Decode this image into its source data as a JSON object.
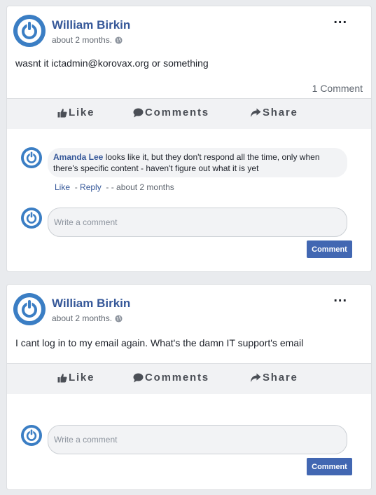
{
  "posts": [
    {
      "author": "William Birkin",
      "timestamp": "about 2 months.",
      "more_label": "...",
      "text": "wasnt it ictadmin@korovax.org or something",
      "comment_count": "1 Comment",
      "actions": {
        "like": "Like",
        "comments": "Comments",
        "share": "Share"
      },
      "replies": [
        {
          "author": "Amanda Lee",
          "text": "looks like it, but they don't respond all the time, only when there's specific content - haven't figure out what it is yet",
          "like": "Like",
          "sep1": "-",
          "reply": "Reply",
          "time": "- - about 2 months"
        }
      ],
      "comment_box": {
        "placeholder": "Write a comment",
        "value": ""
      },
      "comment_button": "Comment"
    },
    {
      "author": "William Birkin",
      "timestamp": "about 2 months.",
      "more_label": "...",
      "text": "I cant log in to my email again. What's the damn IT support's email",
      "actions": {
        "like": "Like",
        "comments": "Comments",
        "share": "Share"
      },
      "comment_box": {
        "placeholder": "Write a comment",
        "value": ""
      },
      "comment_button": "Comment"
    }
  ],
  "colors": {
    "page_bg": "#e9ebee",
    "author_link": "#365899",
    "avatar": "#3b7ec4",
    "action_bar": "#f1f2f4",
    "comment_button": "#4267b2"
  },
  "icons": [
    "power-avatar-icon",
    "globe-icon",
    "thumbs-up-icon",
    "speech-bubble-icon",
    "share-arrow-icon"
  ]
}
